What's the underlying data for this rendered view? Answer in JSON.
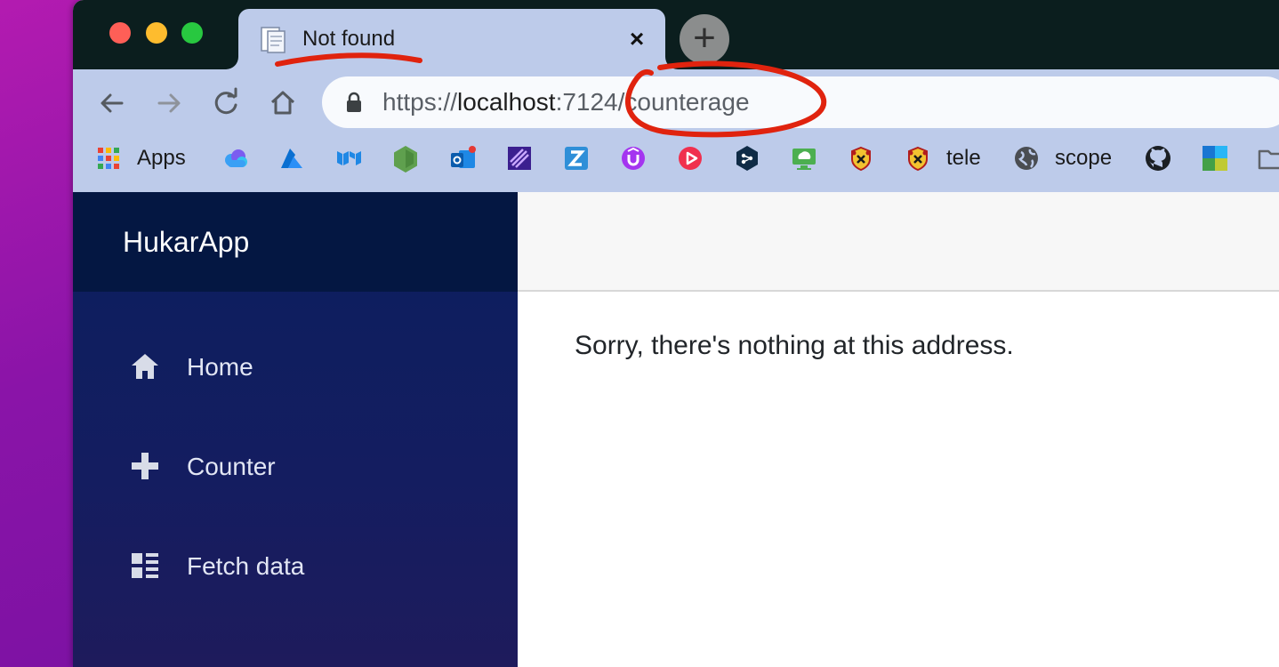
{
  "browser": {
    "tab": {
      "title": "Not found",
      "close_glyph": "×"
    },
    "new_tab_glyph": "+",
    "address": {
      "scheme": "https://",
      "host": "localhost",
      "rest": ":7124/counterage"
    },
    "bookmarks": [
      {
        "icon": "apps-grid-icon",
        "label": "Apps"
      },
      {
        "icon": "cloud-icon",
        "label": ""
      },
      {
        "icon": "azure-icon",
        "label": ""
      },
      {
        "icon": "mui-icon",
        "label": ""
      },
      {
        "icon": "nodejs-icon",
        "label": ""
      },
      {
        "icon": "outlook-icon",
        "label": ""
      },
      {
        "icon": "visual-studio-icon",
        "label": ""
      },
      {
        "icon": "zotero-icon",
        "label": ""
      },
      {
        "icon": "udemy-icon",
        "label": ""
      },
      {
        "icon": "video-play-icon",
        "label": ""
      },
      {
        "icon": "deepl-icon",
        "label": ""
      },
      {
        "icon": "remote-desktop-icon",
        "label": ""
      },
      {
        "icon": "crest-icon",
        "label": ""
      },
      {
        "icon": "crest-icon",
        "label": "tele"
      },
      {
        "icon": "globe-icon",
        "label": "scope"
      },
      {
        "icon": "github-icon",
        "label": ""
      },
      {
        "icon": "microsoft-icon",
        "label": ""
      },
      {
        "icon": "folder-icon",
        "label": ""
      }
    ]
  },
  "app": {
    "brand": "HukarApp",
    "nav": [
      {
        "label": "Home",
        "icon": "home-icon"
      },
      {
        "label": "Counter",
        "icon": "plus-icon"
      },
      {
        "label": "Fetch data",
        "icon": "list-icon"
      }
    ],
    "message": "Sorry, there's nothing at this address."
  },
  "colors": {
    "desktop": "#9a17ab",
    "tab_strip": "#0b1e1e",
    "toolbar": "#bdcbea",
    "sidebar_top": "#041742",
    "sidebar": "#0b1f5e",
    "annotation": "#e0230e"
  }
}
